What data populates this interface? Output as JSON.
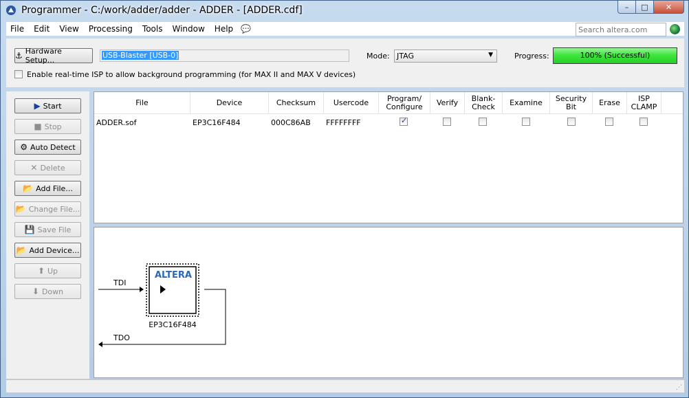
{
  "window": {
    "title": "Programmer - C:/work/adder/adder - ADDER - [ADDER.cdf]",
    "caption_buttons": {
      "minimize": "–",
      "maximize": "□",
      "close": "✕"
    }
  },
  "menu": {
    "items": [
      "File",
      "Edit",
      "View",
      "Processing",
      "Tools",
      "Window",
      "Help"
    ],
    "help_icon": "💬",
    "search_placeholder": "Search altera.com"
  },
  "hardware": {
    "setup_label": "Hardware Setup...",
    "device_value": "USB-Blaster [USB-0]",
    "mode_label": "Mode:",
    "mode_value": "JTAG",
    "progress_label": "Progress:",
    "progress_percent": 100,
    "progress_text": "100% (Successful)",
    "isp_label": "Enable real-time ISP to allow background programming (for MAX II and MAX V devices)",
    "isp_checked": false
  },
  "sidebar": {
    "buttons": [
      {
        "label": "Start",
        "icon": "▶",
        "enabled": true
      },
      {
        "label": "Stop",
        "icon": "■",
        "enabled": false
      },
      {
        "label": "Auto Detect",
        "icon": "⚙",
        "enabled": true
      },
      {
        "label": "Delete",
        "icon": "✕",
        "enabled": false
      },
      {
        "label": "Add File...",
        "icon": "📂",
        "enabled": true
      },
      {
        "label": "Change File...",
        "icon": "📂",
        "enabled": false
      },
      {
        "label": "Save File",
        "icon": "💾",
        "enabled": false
      },
      {
        "label": "Add Device...",
        "icon": "📂",
        "enabled": true
      },
      {
        "label": "Up",
        "icon": "⬆",
        "enabled": false
      },
      {
        "label": "Down",
        "icon": "⬇",
        "enabled": false
      }
    ]
  },
  "table": {
    "headers": {
      "file": "File",
      "device": "Device",
      "checksum": "Checksum",
      "usercode": "Usercode",
      "program": "Program/ Configure",
      "verify": "Verify",
      "blank": "Blank- Check",
      "examine": "Examine",
      "security": "Security Bit",
      "erase": "Erase",
      "isp": "ISP CLAMP"
    },
    "rows": [
      {
        "file": "ADDER.sof",
        "device": "EP3C16F484",
        "checksum": "000C86AB",
        "usercode": "FFFFFFFF",
        "program": true,
        "verify": false,
        "blank": false,
        "examine": false,
        "security": false,
        "erase": false,
        "isp": false
      }
    ]
  },
  "chain": {
    "tdi_label": "TDI",
    "tdo_label": "TDO",
    "device_label": "EP3C16F484",
    "chip_logo": "ALTERA"
  },
  "colors": {
    "progress_green": "#3ee63e",
    "selection_blue": "#3399ff",
    "window_frame": "#b4cbe4"
  }
}
